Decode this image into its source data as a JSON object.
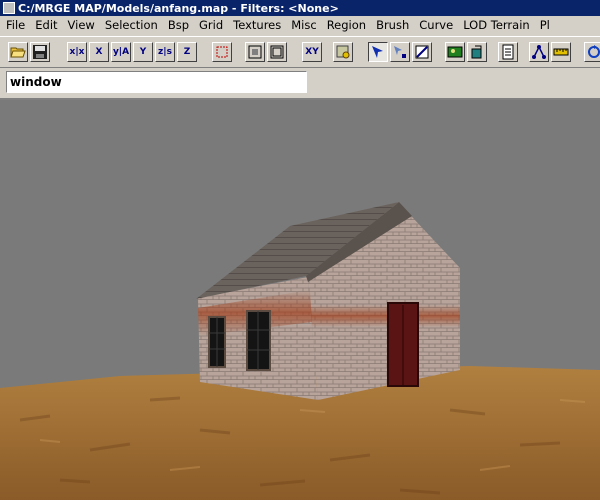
{
  "window": {
    "title": "C:/MRGE MAP/Models/anfang.map - Filters: <None>"
  },
  "menu": {
    "items": [
      "File",
      "Edit",
      "View",
      "Selection",
      "Bsp",
      "Grid",
      "Textures",
      "Misc",
      "Region",
      "Brush",
      "Curve",
      "LOD Terrain",
      "Pl"
    ]
  },
  "toolbar": {
    "buttons": [
      {
        "icon": "open-folder-icon"
      },
      {
        "icon": "save-disk-icon"
      },
      {
        "icon": "flip-x-icon",
        "label": "x|x"
      },
      {
        "icon": "rotate-x-icon",
        "label": "X"
      },
      {
        "icon": "flip-y-icon",
        "label": "y|A"
      },
      {
        "icon": "rotate-y-icon",
        "label": "Y"
      },
      {
        "icon": "flip-z-icon",
        "label": "z|s"
      },
      {
        "icon": "rotate-z-icon",
        "label": "Z"
      },
      {
        "icon": "select-complete-tall-icon"
      },
      {
        "icon": "select-inside-icon"
      },
      {
        "icon": "select-touching-icon"
      },
      {
        "icon": "view-change-icon",
        "label": "XY"
      },
      {
        "icon": "texture-lock-icon"
      },
      {
        "icon": "camera-move-icon"
      },
      {
        "icon": "drag-vertices-icon"
      },
      {
        "icon": "clipper-icon"
      },
      {
        "icon": "texture-view-icon"
      },
      {
        "icon": "cubic-clip-icon"
      },
      {
        "icon": "entity-list-icon"
      },
      {
        "icon": "patch-curve-icon"
      },
      {
        "icon": "measure-ruler-icon"
      },
      {
        "icon": "refresh-icon"
      }
    ],
    "active_index": 13
  },
  "name_field": {
    "value": "window"
  },
  "viewport": {
    "colors": {
      "sky": "#7a7a7a",
      "ground": "#a87a3c",
      "brick": "#b09a8c",
      "roof": "#6a6058",
      "door": "#5a1414"
    }
  }
}
